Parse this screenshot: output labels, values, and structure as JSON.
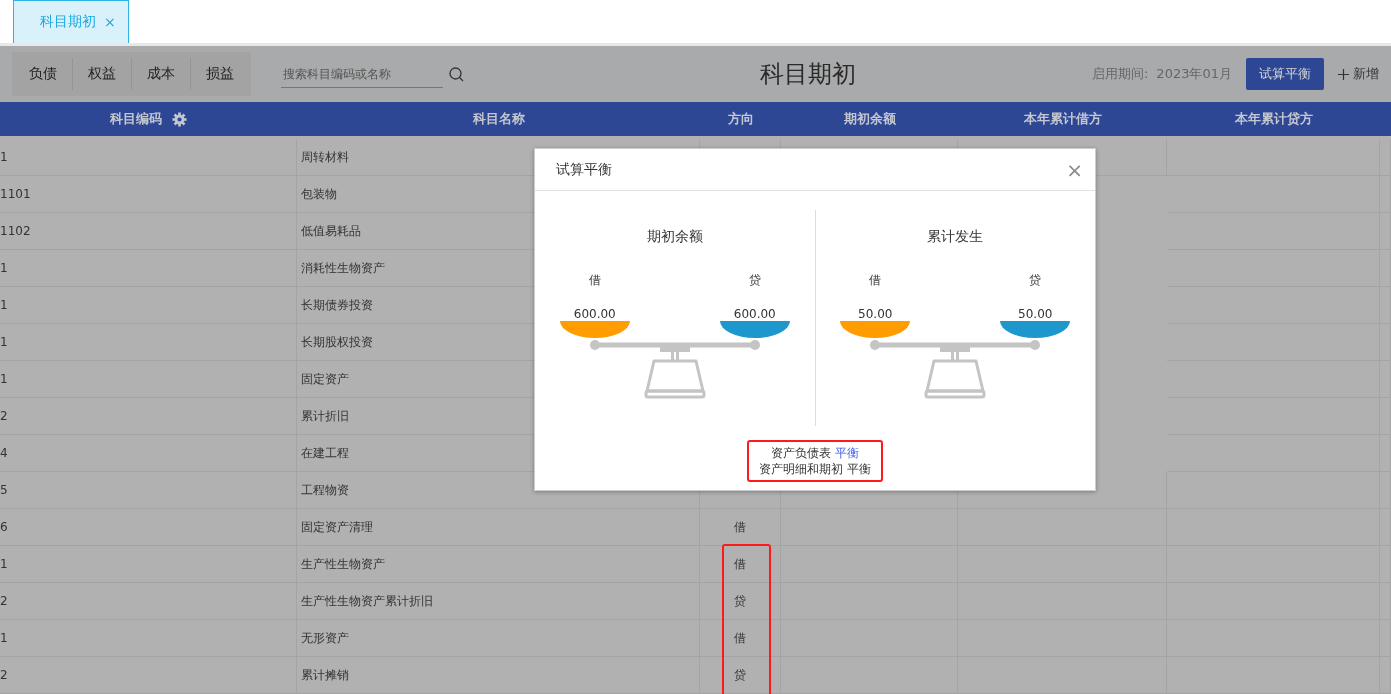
{
  "page_tabs": [
    {
      "label": "科目期初",
      "selected": true,
      "close": "×"
    }
  ],
  "category_tabs": [
    {
      "label": "负债",
      "selected": false
    },
    {
      "label": "权益",
      "selected": false
    },
    {
      "label": "成本",
      "selected": false
    },
    {
      "label": "损益",
      "selected": false
    }
  ],
  "search": {
    "placeholder": "搜索科目编码或名称"
  },
  "title": "科目期初",
  "period": {
    "label": "启用期间:",
    "value": "2023年01月"
  },
  "buttons": [
    {
      "label": "试算平衡",
      "kind": "primary"
    },
    {
      "label": "新增",
      "kind": "add"
    }
  ],
  "table": {
    "columns": [
      "科目编码",
      "科目名称",
      "方向",
      "期初余额",
      "本年累计借方",
      "本年累计贷方"
    ],
    "row_groups": [
      {
        "highlighted": false,
        "rows": [
          {
            "code": "1",
            "name": "周转材料"
          },
          {
            "code": "1101",
            "name": "包装物"
          },
          {
            "code": "1102",
            "name": "低值易耗品"
          },
          {
            "code": "1",
            "name": "消耗性生物资产"
          },
          {
            "code": "1",
            "name": "长期债券投资"
          },
          {
            "code": "1",
            "name": "长期股权投资"
          },
          {
            "code": "1",
            "name": "固定资产"
          },
          {
            "code": "2",
            "name": "累计折旧"
          },
          {
            "code": "4",
            "name": "在建工程"
          },
          {
            "code": "5",
            "name": "工程物资"
          },
          {
            "code": "6",
            "name": "固定资产清理",
            "direction": "借"
          }
        ]
      },
      {
        "highlighted": true,
        "rows": [
          {
            "code": "1",
            "name": "生产性生物资产",
            "direction": "借"
          },
          {
            "code": "2",
            "name": "生产性生物资产累计折旧",
            "direction": "贷"
          },
          {
            "code": "1",
            "name": "无形资产",
            "direction": "借"
          },
          {
            "code": "2",
            "name": "累计摊销",
            "direction": "贷"
          }
        ]
      }
    ]
  },
  "dialog": {
    "title": "试算平衡",
    "close": "×",
    "panels": [
      {
        "title": "期初余额",
        "debit_label": "借",
        "credit_label": "贷",
        "debit": "600.00",
        "credit": "600.00"
      },
      {
        "title": "累计发生",
        "debit_label": "借",
        "credit_label": "贷",
        "debit": "50.00",
        "credit": "50.00"
      }
    ],
    "note_highlighted": true,
    "notes": [
      {
        "label": "资产负债表",
        "status": "平衡",
        "highlighted": true
      },
      {
        "label": "资产明细和期初",
        "status": "平衡",
        "highlighted": false
      }
    ]
  }
}
